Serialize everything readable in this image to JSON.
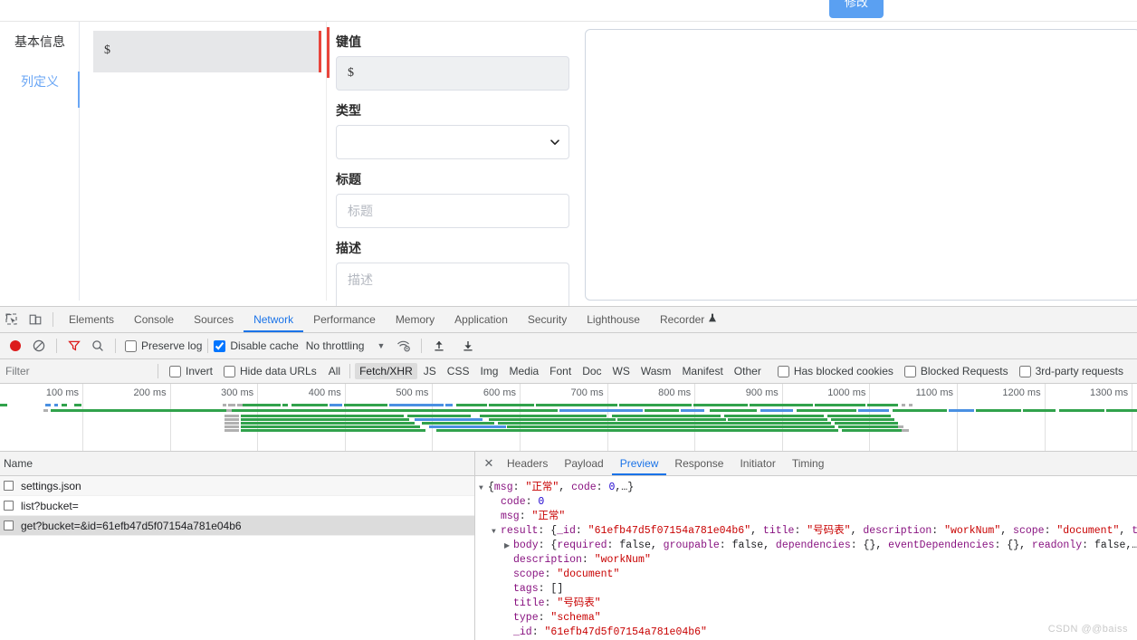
{
  "app": {
    "modify_button": "修改",
    "vtabs": [
      {
        "label": "基本信息",
        "active": false
      },
      {
        "label": "列定义",
        "active": true
      }
    ],
    "column_list": [
      {
        "label": "$",
        "selected": true
      }
    ],
    "form": {
      "key_label": "键值",
      "key_value": "$",
      "type_label": "类型",
      "type_value": "",
      "title_label": "标题",
      "title_placeholder": "标题",
      "title_value": "",
      "desc_label": "描述",
      "desc_placeholder": "描述",
      "desc_value": ""
    }
  },
  "devtools": {
    "panel_tabs": [
      {
        "label": "Elements",
        "active": false
      },
      {
        "label": "Console",
        "active": false
      },
      {
        "label": "Sources",
        "active": false
      },
      {
        "label": "Network",
        "active": true
      },
      {
        "label": "Performance",
        "active": false
      },
      {
        "label": "Memory",
        "active": false
      },
      {
        "label": "Application",
        "active": false
      },
      {
        "label": "Security",
        "active": false
      },
      {
        "label": "Lighthouse",
        "active": false
      },
      {
        "label": "Recorder",
        "active": false
      }
    ],
    "toolbar": {
      "preserve_log": "Preserve log",
      "preserve_log_checked": false,
      "disable_cache": "Disable cache",
      "disable_cache_checked": true,
      "throttling": "No throttling"
    },
    "filterbar": {
      "filter_placeholder": "Filter",
      "filter_value": "",
      "invert": "Invert",
      "hide_data_urls": "Hide data URLs",
      "types": [
        {
          "label": "All",
          "active": false
        },
        {
          "label": "Fetch/XHR",
          "active": true
        },
        {
          "label": "JS",
          "active": false
        },
        {
          "label": "CSS",
          "active": false
        },
        {
          "label": "Img",
          "active": false
        },
        {
          "label": "Media",
          "active": false
        },
        {
          "label": "Font",
          "active": false
        },
        {
          "label": "Doc",
          "active": false
        },
        {
          "label": "WS",
          "active": false
        },
        {
          "label": "Wasm",
          "active": false
        },
        {
          "label": "Manifest",
          "active": false
        },
        {
          "label": "Other",
          "active": false
        }
      ],
      "has_blocked_cookies": "Has blocked cookies",
      "blocked_requests": "Blocked Requests",
      "third_party_requests": "3rd-party requests"
    },
    "overview": {
      "ticks": [
        "100 ms",
        "200 ms",
        "300 ms",
        "400 ms",
        "500 ms",
        "600 ms",
        "700 ms",
        "800 ms",
        "900 ms",
        "1000 ms",
        "1100 ms",
        "1200 ms",
        "1300 ms"
      ]
    },
    "requests": {
      "name_header": "Name",
      "rows": [
        {
          "name": "settings.json",
          "selected": false
        },
        {
          "name": "list?bucket=",
          "selected": false
        },
        {
          "name": "get?bucket=&id=61efb47d5f07154a781e04b6",
          "selected": true
        }
      ]
    },
    "detail": {
      "tabs": [
        {
          "label": "Headers",
          "active": false
        },
        {
          "label": "Payload",
          "active": false
        },
        {
          "label": "Preview",
          "active": true
        },
        {
          "label": "Response",
          "active": false
        },
        {
          "label": "Initiator",
          "active": false
        },
        {
          "label": "Timing",
          "active": false
        }
      ],
      "preview_lines": [
        {
          "indent": 0,
          "tri": "▼",
          "text": "{msg: \"正常\", code: 0,…}"
        },
        {
          "indent": 1,
          "tri": "",
          "text": "code: 0"
        },
        {
          "indent": 1,
          "tri": "",
          "text": "msg: \"正常\""
        },
        {
          "indent": 1,
          "tri": "▼",
          "text": "result: {_id: \"61efb47d5f07154a781e04b6\", title: \"号码表\", description: \"workNum\", scope: \"document\", tags:"
        },
        {
          "indent": 2,
          "tri": "▶",
          "text": "body: {required: false, groupable: false, dependencies: {}, eventDependencies: {}, readonly: false,…}"
        },
        {
          "indent": 2,
          "tri": "",
          "text": "description: \"workNum\""
        },
        {
          "indent": 2,
          "tri": "",
          "text": "scope: \"document\""
        },
        {
          "indent": 2,
          "tri": "",
          "text": "tags: []"
        },
        {
          "indent": 2,
          "tri": "",
          "text": "title: \"号码表\""
        },
        {
          "indent": 2,
          "tri": "",
          "text": "type: \"schema\""
        },
        {
          "indent": 2,
          "tri": "",
          "text": "_id: \"61efb47d5f07154a781e04b6\""
        }
      ]
    }
  },
  "watermark": "CSDN @@baiss",
  "colors": {
    "accent_blue": "#1a73e8",
    "button_blue": "#5aa0f2",
    "accent_red": "#e8453c",
    "waterfall_green": "#31a24c",
    "waterfall_blue": "#4a90e2"
  }
}
